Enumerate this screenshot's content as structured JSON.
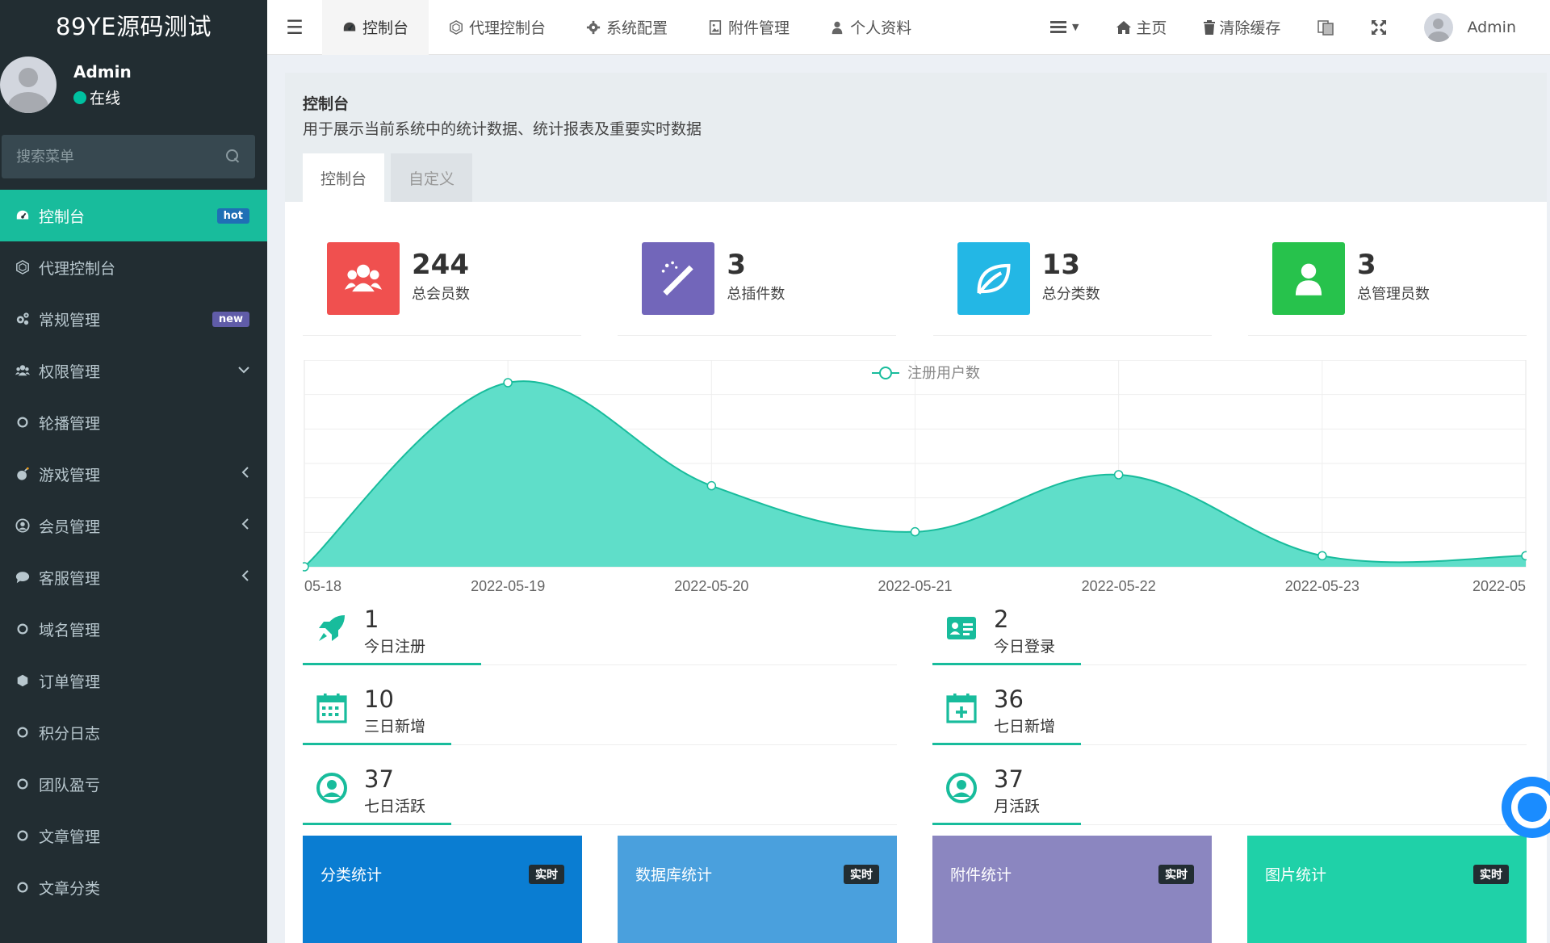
{
  "sidebar": {
    "logo": "89YE源码测试",
    "user": {
      "name": "Admin",
      "status": "在线"
    },
    "search_placeholder": "搜索菜单",
    "items": [
      {
        "label": "控制台",
        "icon": "dashboard-icon",
        "badge": "hot",
        "active": true
      },
      {
        "label": "代理控制台",
        "icon": "cube-outline-icon"
      },
      {
        "label": "常规管理",
        "icon": "cogs-icon",
        "badge": "new"
      },
      {
        "label": "权限管理",
        "icon": "users-icon",
        "chevron": "down"
      },
      {
        "label": "轮播管理",
        "icon": "circle-icon"
      },
      {
        "label": "游戏管理",
        "icon": "bomb-icon",
        "chevron": "left"
      },
      {
        "label": "会员管理",
        "icon": "user-circle-icon",
        "chevron": "left"
      },
      {
        "label": "客服管理",
        "icon": "comment-icon",
        "chevron": "left"
      },
      {
        "label": "域名管理",
        "icon": "circle-icon"
      },
      {
        "label": "订单管理",
        "icon": "hexagon-icon"
      },
      {
        "label": "积分日志",
        "icon": "circle-icon"
      },
      {
        "label": "团队盈亏",
        "icon": "circle-icon"
      },
      {
        "label": "文章管理",
        "icon": "circle-icon"
      },
      {
        "label": "文章分类",
        "icon": "circle-icon"
      }
    ]
  },
  "topbar": {
    "tabs": [
      {
        "label": "控制台",
        "icon": "dashboard-icon",
        "active": true
      },
      {
        "label": "代理控制台",
        "icon": "cube-outline-icon"
      },
      {
        "label": "系统配置",
        "icon": "gear-icon"
      },
      {
        "label": "附件管理",
        "icon": "image-file-icon"
      },
      {
        "label": "个人资料",
        "icon": "user-icon"
      }
    ],
    "right": {
      "home": "主页",
      "clear_cache": "清除缓存",
      "user": "Admin"
    }
  },
  "panel": {
    "title": "控制台",
    "description": "用于展示当前系统中的统计数据、统计报表及重要实时数据",
    "tabs": [
      "控制台",
      "自定义"
    ]
  },
  "stats": [
    {
      "value": "244",
      "label": "总会员数",
      "color": "#f0504f",
      "icon": "users-icon"
    },
    {
      "value": "3",
      "label": "总插件数",
      "color": "#7266ba",
      "icon": "magic-wand-icon"
    },
    {
      "value": "13",
      "label": "总分类数",
      "color": "#23b7e5",
      "icon": "leaf-icon"
    },
    {
      "value": "3",
      "label": "总管理员数",
      "color": "#27c24c",
      "icon": "user-icon"
    }
  ],
  "chart_data": {
    "type": "area",
    "legend": "注册用户数",
    "x_labels": [
      "05-18",
      "2022-05-19",
      "2022-05-20",
      "2022-05-21",
      "2022-05-22",
      "2022-05-23",
      "2022-05"
    ],
    "values": [
      0,
      100,
      44,
      19,
      50,
      6,
      6
    ],
    "color": "#18bc9c"
  },
  "metrics": [
    {
      "value": "1",
      "label": "今日注册",
      "icon": "rocket-icon",
      "progress": 0.3
    },
    {
      "value": "2",
      "label": "今日登录",
      "icon": "id-card-icon",
      "progress": 0.25
    },
    {
      "value": "10",
      "label": "三日新增",
      "icon": "calendar-icon",
      "progress": 0.25
    },
    {
      "value": "36",
      "label": "七日新增",
      "icon": "calendar-plus-icon",
      "progress": 0.25
    },
    {
      "value": "37",
      "label": "七日活跃",
      "icon": "user-circle-icon",
      "progress": 0.25
    },
    {
      "value": "37",
      "label": "月活跃",
      "icon": "user-circle-icon",
      "progress": 0.25
    }
  ],
  "bottom_cards": [
    {
      "title": "分类统计",
      "badge": "实时",
      "color": "#0a7dd2"
    },
    {
      "title": "数据库统计",
      "badge": "实时",
      "color": "#4aa0dd"
    },
    {
      "title": "附件统计",
      "badge": "实时",
      "color": "#8b86c0"
    },
    {
      "title": "图片统计",
      "badge": "实时",
      "color": "#1fd1a8"
    }
  ]
}
